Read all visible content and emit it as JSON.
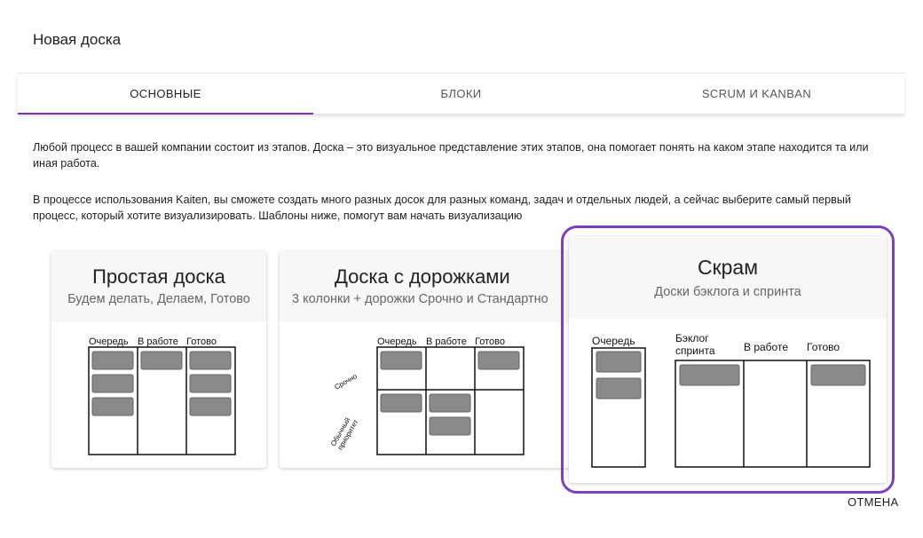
{
  "dialog": {
    "title": "Новая доска"
  },
  "tabs": [
    {
      "label": "Основные",
      "active": true
    },
    {
      "label": "Блоки",
      "active": false
    },
    {
      "label": "Scrum и Kanban",
      "active": false
    }
  ],
  "intro": {
    "paragraph1": "Любой процесс в вашей компании состоит из этапов. Доска – это визуальное представление этих этапов, она помогает понять на каком этапе находится та или иная работа.",
    "paragraph2": "В процессе использования Kaiten, вы сможете создать много разных досок для разных команд, задач и отдельных людей, а сейчас выберите самый первый процесс, который хотите визуализировать. Шаблоны ниже, помогут вам начать визуализацию"
  },
  "templates": [
    {
      "title": "Простая доска",
      "subtitle": "Будем делать, Делаем, Готово",
      "columns": [
        "Очередь",
        "В работе",
        "Готово"
      ]
    },
    {
      "title": "Доска с дорожками",
      "subtitle": "3 колонки + дорожки Срочно и Стандартно",
      "columns": [
        "Очередь",
        "В работе",
        "Готово"
      ],
      "lanes": [
        "Срочно",
        "Обычный приоритет"
      ]
    },
    {
      "title": "Скрам",
      "subtitle": "Доски бэклога и спринта",
      "selected": true,
      "columns": [
        "Очередь",
        "Бэклог спринта",
        "В работе",
        "Готово"
      ]
    }
  ],
  "actions": {
    "cancel_label": "ОТМЕНА"
  },
  "colors": {
    "accent": "#7b2fb5",
    "highlight": "#7b3fc4",
    "card_block": "#8a8a8a"
  }
}
